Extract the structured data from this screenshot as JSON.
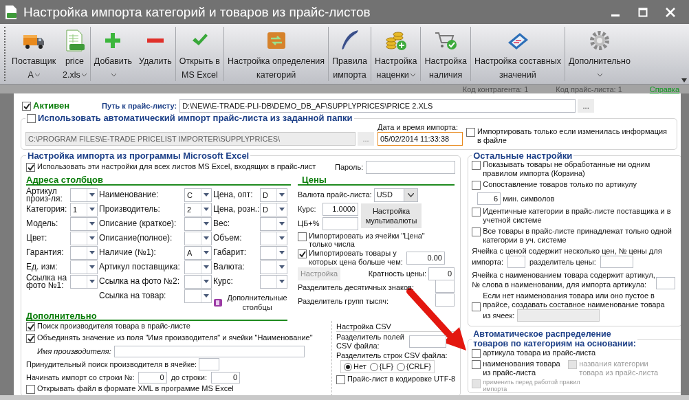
{
  "window": {
    "title": "Настройка импорта категорий и товаров из прайс-листов"
  },
  "toolbar": [
    {
      "kind": "truck",
      "separator": false,
      "lines": [
        "Поставщик",
        "A"
      ],
      "dropdown": true
    },
    {
      "kind": "sheet",
      "separator": false,
      "lines": [
        "price",
        "2.xls"
      ],
      "dropdown": true
    },
    {
      "kind": "plus",
      "separator": true,
      "lines": [
        "Добавить"
      ],
      "dropdown": true
    },
    {
      "kind": "minus",
      "separator": false,
      "lines": [
        "Удалить"
      ],
      "dropdown": false
    },
    {
      "kind": "check",
      "separator": true,
      "lines": [
        "Открыть в",
        "MS Excel"
      ],
      "dropdown": false
    },
    {
      "kind": "categories",
      "separator": true,
      "lines": [
        "Настройка определения",
        "категорий"
      ],
      "dropdown": false
    },
    {
      "kind": "quill",
      "separator": true,
      "lines": [
        "Правила",
        "импорта"
      ],
      "dropdown": false
    },
    {
      "kind": "coins",
      "separator": true,
      "lines": [
        "Настройка",
        "наценки"
      ],
      "dropdown": true
    },
    {
      "kind": "cart",
      "separator": true,
      "lines": [
        "Настройка",
        "наличия"
      ],
      "dropdown": false
    },
    {
      "kind": "panel",
      "separator": true,
      "lines": [
        "Настройка составных",
        "значений"
      ],
      "dropdown": false
    },
    {
      "kind": "gear",
      "separator": true,
      "lines": [
        "Дополнительно"
      ],
      "dropdown": true
    }
  ],
  "status": {
    "fields": [
      "Код контрагента: 1",
      "Код прайс-листа: 1"
    ],
    "link": "Справка"
  },
  "active": {
    "label": "Активен",
    "checked": true
  },
  "path": {
    "label": "Путь к прайс-листу:",
    "value": "D:\\NEW\\E-TRADE-PLI-DB\\DEMO_DB_AF\\SUPPLYPRICES\\PRICE 2.XLS",
    "browse": "..."
  },
  "auto_import": {
    "label": "Использовать автоматический импорт прайс-листа из заданной папки",
    "checked": false,
    "folder": {
      "value": "C:\\PROGRAM FILES\\E-TRADE PRICELIST IMPORTER\\SUPPLYPRICES\\",
      "disabled": true
    },
    "browse": "...",
    "date_label": "Дата и время импорта:",
    "date": "05/02/2014 11:33:38",
    "only_changed": {
      "label": "Импортировать только если изменилась информация в файле",
      "checked": false
    }
  },
  "excel": {
    "title": "Настройка импорта из программы Microsoft Excel",
    "use_for_all": {
      "label": "Использовать эти настройки для всех листов MS Excel, входящих в прайс-лист",
      "checked": true
    },
    "password_label": "Пароль:",
    "columns_title": "Адреса столбцов",
    "columns": [
      [
        {
          "label": "Артикул произ-ля:"
        },
        {
          "label": "Категория:",
          "value": "1"
        },
        {
          "label": "Модель:"
        },
        {
          "label": "Цвет:"
        },
        {
          "label": "Гарантия:"
        },
        {
          "label": "Ед. изм:"
        },
        {
          "label": "Ссылка на фото №1:"
        }
      ],
      [
        {
          "label": "Наименование:",
          "value": "C"
        },
        {
          "label": "Производитель:",
          "value": "2"
        },
        {
          "label": "Описание (краткое):"
        },
        {
          "label": "Описание(полное):"
        },
        {
          "label": "Наличие (№1):",
          "value": "A"
        },
        {
          "label": "Артикул поставщика:"
        },
        {
          "label": "Ссылка на фото №2:"
        },
        {
          "label": "Ссылка на товар:"
        }
      ],
      [
        {
          "label": "Цена, опт:",
          "value": "D"
        },
        {
          "label": "Цена, розн.:",
          "value": "D"
        },
        {
          "label": "Вес:"
        },
        {
          "label": "Объем:"
        },
        {
          "label": "Габарит:"
        },
        {
          "label": "Валюта:"
        },
        {
          "label": "Курс:"
        }
      ]
    ],
    "extra_columns": "Дополнительные столбцы",
    "prices": {
      "title": "Цены",
      "currency_label": "Валюта прайс-листа:",
      "currency": "USD",
      "rate_label": "Курс:",
      "rate": "1.0000",
      "multicurrency": "Настройка мультивалюты",
      "cb_label": "ЦБ+%",
      "numbers_only": {
        "label": "Импортировать из ячейки \"Цена\" только числа",
        "checked": false
      },
      "min_price": {
        "label": "Импортировать товары у которых цена больше чем:",
        "checked": true,
        "value": "0.00"
      },
      "setup": {
        "label": "Настройка",
        "disabled": true
      },
      "multiple_label": "Кратность цены:",
      "multiple": "0",
      "decimal_label": "Разделитель десятичных знаков:",
      "thousands_label": "Разделитель групп тысяч:"
    },
    "extra": {
      "title": "Дополнительно",
      "find_maker": {
        "label": "Поиск производителя товара в прайс-листе",
        "checked": true
      },
      "merge": {
        "label": "Объединять значение из поля \"Имя производителя\" и ячейки \"Наименование\"",
        "checked": true
      },
      "maker_label": "Имя производителя:",
      "forced_label": "Принудительный поиск производителя в ячейке:",
      "start_label": "Начинать импорт со строки №:",
      "start": "0",
      "end_label": "до строки:",
      "end": "0",
      "xml": {
        "label": "Открывать файл в формате XML в программе MS Excel",
        "checked": false
      }
    },
    "csv": {
      "title": "Настройка CSV",
      "field_sep_label": "Разделитель полей CSV файла:",
      "row_sep_label": "Разделитель строк CSV файла:",
      "row_sep": [
        {
          "label": "Нет",
          "selected": true
        },
        {
          "label": "{LF}",
          "selected": false
        },
        {
          "label": "{CRLF}",
          "selected": false
        }
      ],
      "utf8": {
        "label": "Прайс-лист в кодировке UTF-8",
        "checked": false
      }
    }
  },
  "other": {
    "title": "Остальные настройки",
    "items": [
      {
        "kind": "check",
        "label": "Показывать товары не обработанные ни одним правилом импорта (Корзина)",
        "checked": false
      },
      {
        "kind": "check",
        "label": "Сопоставление товаров только по артикулу",
        "checked": false
      },
      {
        "kind": "number",
        "value": "6",
        "label": "мин. символов"
      },
      {
        "kind": "check",
        "label": "Идентичные категории в прайс-листе поставщика и в учетной системе",
        "checked": false
      },
      {
        "kind": "check",
        "label": "Все товары в прайс-листе принадлежат только одной категории в уч. системе",
        "checked": false
      },
      {
        "kind": "multi_price",
        "label": "Ячейка с ценой содержит несколько цен, № цены для",
        "label_2": "импорта:",
        "sep_label": "разделитель цены:"
      },
      {
        "kind": "article_word",
        "label": "Ячейка с наименованием товара содержит артикул, № слова в наименовании, для импорта артикула:"
      },
      {
        "kind": "composite",
        "label": "Если нет наименования товара или оно пустое в прайсе, создавать составное наименование товара",
        "label_2": "из ячеек:",
        "checked": false,
        "field_disabled": true
      }
    ]
  },
  "auto": {
    "title_lines": [
      "Автоматическое распределение",
      "товаров по категориям на основании:"
    ],
    "by_article": {
      "label": "артикула товара из прайс-листа",
      "checked": false
    },
    "by_name": {
      "label": "наименования товара из прайс-листа",
      "checked": false
    },
    "by_category": {
      "label": "названия  категории товара из прайс-листа",
      "checked": false,
      "disabled": true
    },
    "before_rules": {
      "label": "применить перед работой правил импорта",
      "checked": false,
      "disabled": true
    }
  }
}
